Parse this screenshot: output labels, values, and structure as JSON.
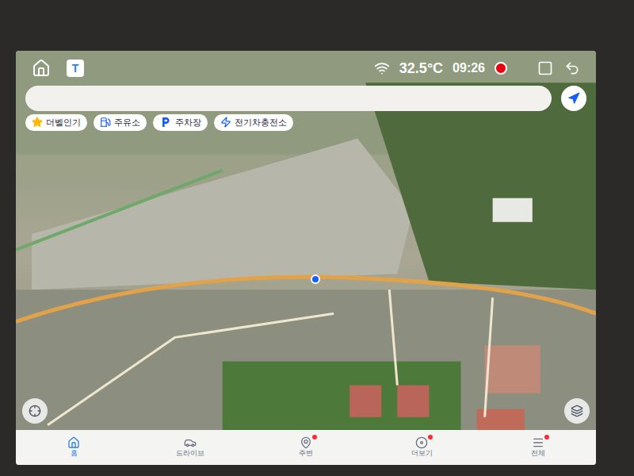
{
  "app_logo": "T",
  "status": {
    "temperature": "32.5°C",
    "time": "09:26"
  },
  "chips": [
    {
      "label": "더벨인기"
    },
    {
      "label": "주유소"
    },
    {
      "label": "주차장"
    },
    {
      "label": "전기차충전소"
    }
  ],
  "nav": [
    {
      "label": "홈",
      "selected": true,
      "badge": false
    },
    {
      "label": "드라이브",
      "selected": false,
      "badge": false
    },
    {
      "label": "주변",
      "selected": false,
      "badge": true
    },
    {
      "label": "더보기",
      "selected": false,
      "badge": true
    },
    {
      "label": "전체",
      "selected": false,
      "badge": true
    }
  ]
}
